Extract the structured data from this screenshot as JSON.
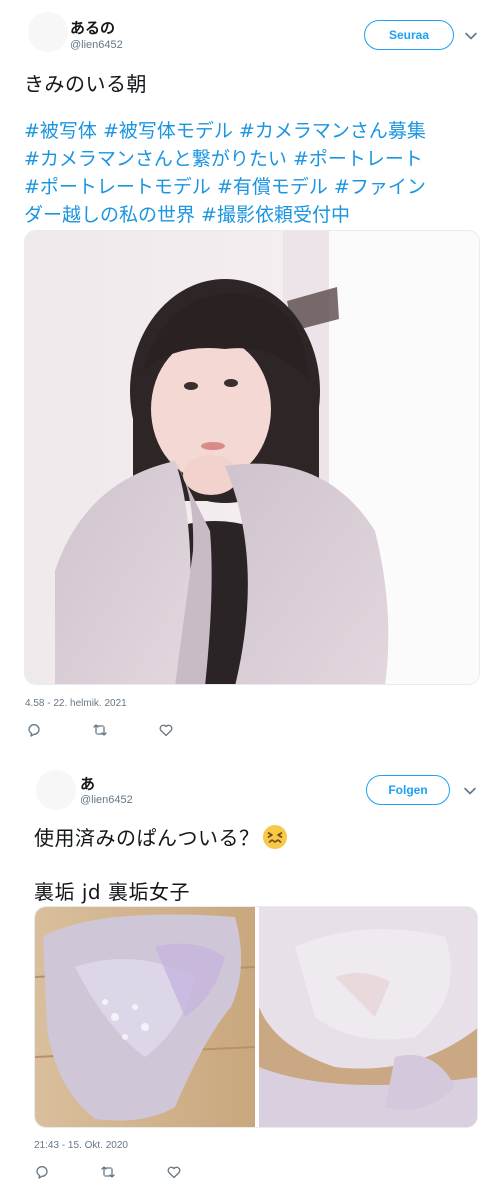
{
  "tweet1": {
    "author_name": "あるの",
    "author_handle": "@lien6452",
    "follow_label": "Seuraa",
    "text": "きみのいる朝",
    "hashtag_lines": [
      "#被写体 #被写体モデル #カメラマンさん募集",
      "#カメラマンさんと繋がりたい #ポートレート",
      "#ポートレートモデル #有償モデル #ファイン",
      "ダー越しの私の世界 #撮影依頼受付中"
    ],
    "timestamp": "4.58 - 22. helmik. 2021",
    "photo_icon": "portrait-photo"
  },
  "tweet2": {
    "author_name": "あ",
    "author_handle": "@lien6452",
    "follow_label": "Folgen",
    "text": "使用済みのぱんついる？",
    "emoji": "confounded-face",
    "tags_line": "裏垢 jd  裏垢女子",
    "timestamp": "21:43 - 15. Okt. 2020",
    "photo_icon": "clothing-photos"
  },
  "colors": {
    "accent": "#1da1f2",
    "hashtag": "#1b95e0",
    "muted": "#657786"
  }
}
